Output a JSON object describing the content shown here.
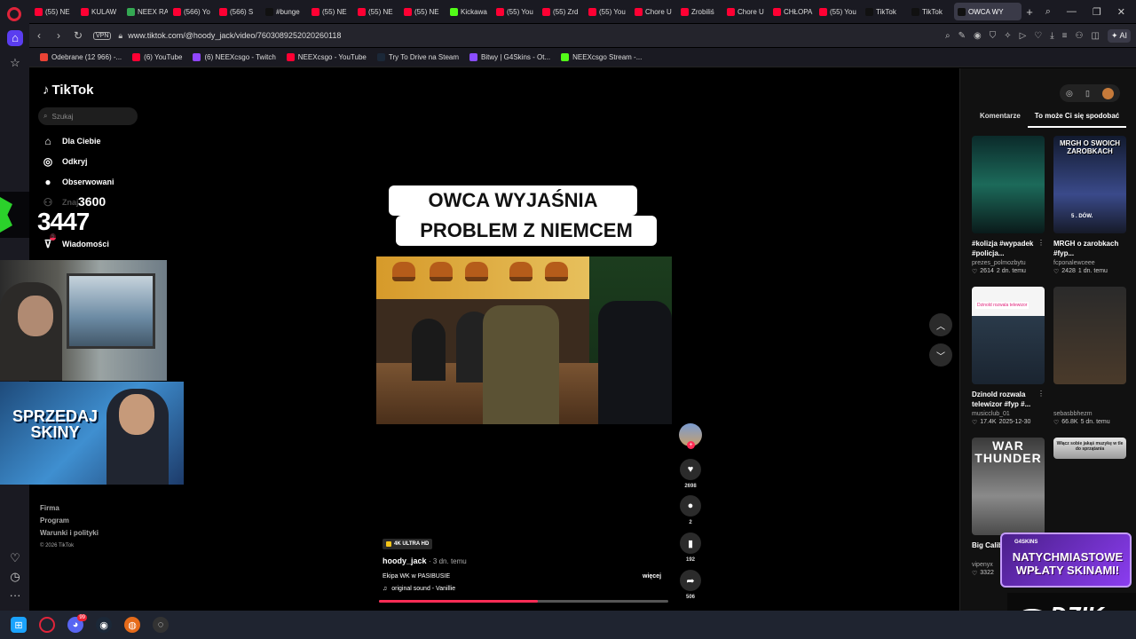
{
  "browser": {
    "tabs": [
      {
        "label": "(55) NE",
        "color": "#ff0033"
      },
      {
        "label": "KULAW",
        "color": "#ff0033"
      },
      {
        "label": "NEEX RA",
        "color": "#34a853"
      },
      {
        "label": "(566) Yo",
        "color": "#ff0033"
      },
      {
        "label": "(566) S",
        "color": "#ff0033"
      },
      {
        "label": "#bunge",
        "color": "#111111"
      },
      {
        "label": "(55) NE",
        "color": "#ff0033"
      },
      {
        "label": "(55) NE",
        "color": "#ff0033"
      },
      {
        "label": "(55) NE",
        "color": "#ff0033"
      },
      {
        "label": "Kickawa",
        "color": "#53fc18"
      },
      {
        "label": "(55) You",
        "color": "#ff0033"
      },
      {
        "label": "(55) Zrd",
        "color": "#ff0033"
      },
      {
        "label": "(55) You",
        "color": "#ff0033"
      },
      {
        "label": "Chore U",
        "color": "#ff0033"
      },
      {
        "label": "Zrobiliś",
        "color": "#ff0033"
      },
      {
        "label": "Chore U",
        "color": "#ff0033"
      },
      {
        "label": "CHŁOPA",
        "color": "#ff0033"
      },
      {
        "label": "(55) You",
        "color": "#ff0033"
      },
      {
        "label": "TikTok",
        "color": "#111111"
      },
      {
        "label": "TikTok",
        "color": "#111111"
      },
      {
        "label": "OWCA WY",
        "color": "#111111",
        "active": true
      }
    ],
    "new_tab": "+",
    "url": "www.tiktok.com/@hoody_jack/video/7603089252020260118",
    "vpn_label": "VPN",
    "ai_label": "AI",
    "bookmarks": [
      {
        "label": "Odebrane (12 966) -...",
        "color": "#ea4335"
      },
      {
        "label": "(6) YouTube",
        "color": "#ff0033"
      },
      {
        "label": "(6) NEEXcsgo - Twitch",
        "color": "#9146ff"
      },
      {
        "label": "NEEXcsgo - YouTube",
        "color": "#ff0033"
      },
      {
        "label": "Try To Drive na Steam",
        "color": "#1b2838"
      },
      {
        "label": "Bitwy | G4Skins - Ot...",
        "color": "#8a4dff"
      },
      {
        "label": "NEEXcsgo Stream -...",
        "color": "#53fc18"
      }
    ]
  },
  "tiktok": {
    "logo": "TikTok",
    "search_placeholder": "Szukaj",
    "nav": [
      {
        "label": "Dla Ciebie",
        "icon": "home-icon"
      },
      {
        "label": "Odkryj",
        "icon": "compass-icon"
      },
      {
        "label": "Obserwowani",
        "icon": "avatar-icon"
      },
      {
        "label": "Znaj",
        "icon": "friends-icon"
      },
      {
        "label": "Wiadomości",
        "icon": "inbox-icon",
        "badge": "5"
      }
    ],
    "footer": {
      "links": [
        "Firma",
        "Program",
        "Warunki i polityki"
      ],
      "copyright": "© 2026 TikTok"
    }
  },
  "overlay": {
    "counter_sub": "3600",
    "counter_main": "3447",
    "promo_skiny": "SPRZEDAJ SKINY",
    "promo_wplaty_brand": "G4SKINS",
    "promo_wplaty": "NATYCHMIASTOWE WPŁATY SKINAMI!",
    "dzik": "DZIK"
  },
  "video": {
    "caption_line1": "OWCA WYJAŚNIA",
    "caption_line2": "PROBLEM Z NIEMCEM",
    "badge": "4K ULTRA HD",
    "author": "hoody_jack",
    "date": "· 3 dn. temu",
    "description": "Ekipa WK w PASIBUSIE",
    "more": "więcej",
    "sound": "original sound - Vanillie",
    "progress": 0.55,
    "likes": "2698",
    "comments": "2",
    "saves": "192",
    "shares": "506"
  },
  "side": {
    "tabs": [
      "Komentarze",
      "To może Ci się spodobać"
    ],
    "active_tab": 1,
    "cards": [
      {
        "title": "#kolizja #wypadek #policja...",
        "author": "prezes_polmozbytu",
        "likes": "2614",
        "date": "2 dn. temu"
      },
      {
        "title": "MRGH o zarobkach #fyp...",
        "author": "fcponalewceee",
        "likes": "2428",
        "date": "1 dn. temu",
        "thumb_text": "MRGH O SWOICH ZAROBKACH",
        "thumb_sub": "5 . DÓW."
      },
      {
        "title": "Dzinold rozwala telewizor #fyp #...",
        "author": "musicclub_01",
        "likes": "17.4K",
        "date": "2025-12-30",
        "thumb_text": "Dzinold rozwala telewizor"
      },
      {
        "title": "",
        "author": "sebasbbhezm",
        "likes": "66.8K",
        "date": "5 dn. temu"
      },
      {
        "title": "Big Calib Thunder",
        "author": "vipenyx",
        "likes": "3322",
        "date": "",
        "thumb_text": "WAR THUNDER"
      },
      {
        "title": "",
        "author": "",
        "likes": "",
        "date": "",
        "thumb_text": "Włącz sobie jakąś muzykę w tle do sprzątania"
      }
    ]
  },
  "colors": {
    "accent": "#fe2c55",
    "opera": "#e0243a",
    "rail_active": "#5a3df0"
  }
}
